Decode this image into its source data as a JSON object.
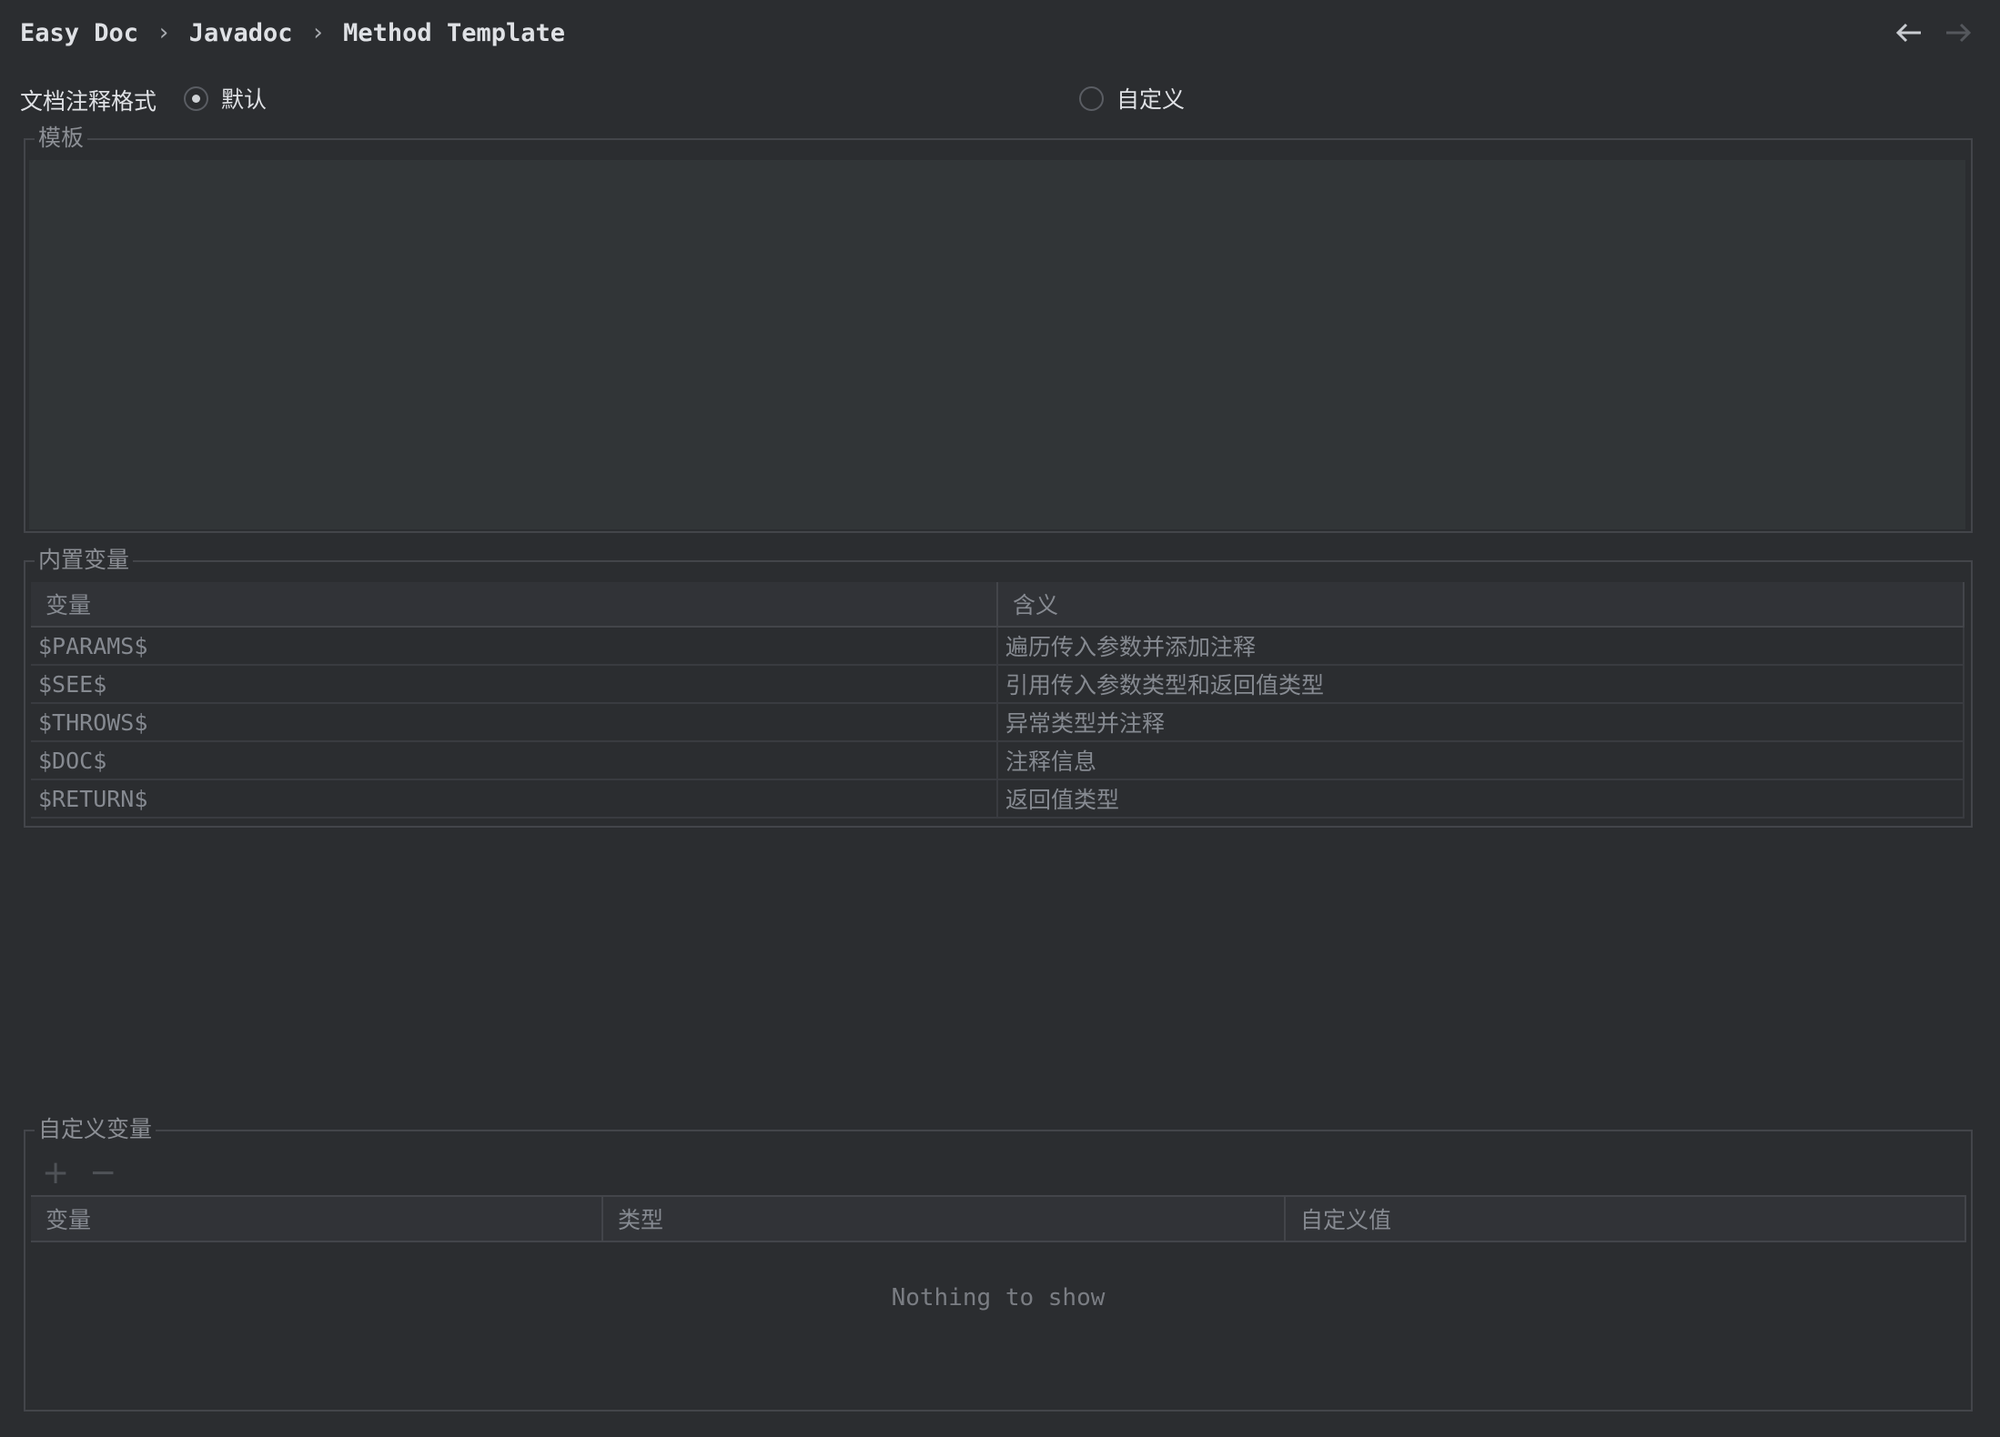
{
  "breadcrumb": {
    "items": [
      "Easy Doc",
      "Javadoc",
      "Method Template"
    ],
    "separator": "›"
  },
  "nav": {
    "back_icon": "arrow-left-icon",
    "forward_icon": "arrow-right-icon"
  },
  "format": {
    "label": "文档注释格式",
    "options": [
      {
        "label": "默认",
        "selected": true
      },
      {
        "label": "自定义",
        "selected": false
      }
    ]
  },
  "template_group": {
    "title": "模板",
    "value": ""
  },
  "builtin_group": {
    "title": "内置变量",
    "columns": [
      "变量",
      "含义"
    ],
    "rows": [
      {
        "variable": "$PARAMS$",
        "meaning": "遍历传入参数并添加注释"
      },
      {
        "variable": "$SEE$",
        "meaning": "引用传入参数类型和返回值类型"
      },
      {
        "variable": "$THROWS$",
        "meaning": "异常类型并注释"
      },
      {
        "variable": "$DOC$",
        "meaning": "注释信息"
      },
      {
        "variable": "$RETURN$",
        "meaning": "返回值类型"
      }
    ]
  },
  "custom_group": {
    "title": "自定义变量",
    "add_label": "+",
    "remove_label": "−",
    "columns": [
      "变量",
      "类型",
      "自定义值"
    ],
    "empty_text": "Nothing to show"
  },
  "colors": {
    "background": "#2b2d30",
    "template_bg": "#313537",
    "border": "#43454a",
    "text_primary": "#dfe1e5",
    "text_muted": "#868a91"
  }
}
